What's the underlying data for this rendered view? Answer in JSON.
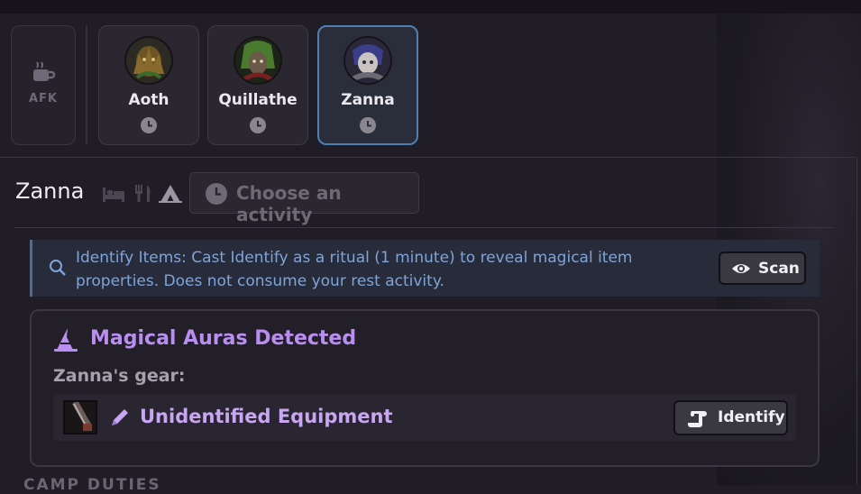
{
  "party": {
    "afk_label": "AFK",
    "members": [
      {
        "name": "Aoth",
        "status_icon": "clock-icon"
      },
      {
        "name": "Quillathe",
        "status_icon": "clock-icon"
      },
      {
        "name": "Zanna",
        "status_icon": "clock-icon",
        "selected": true
      }
    ]
  },
  "selected": {
    "name": "Zanna",
    "rest_icons": [
      "bed-icon",
      "fork-knife-icon",
      "tent-icon"
    ],
    "activity_placeholder": "Choose an activity"
  },
  "identify_info": {
    "text": "Identify Items: Cast Identify as a ritual (1 minute) to reveal magical item properties. Does not consume your rest activity.",
    "scan_label": "Scan"
  },
  "auras": {
    "title": "Magical Auras Detected",
    "gear_label": "Zanna's gear:",
    "items": [
      {
        "name": "Unidentified Equipment",
        "button_label": "Identify"
      }
    ]
  },
  "section_next": "CAMP DUTIES",
  "colors": {
    "background": "#201d26",
    "accent_selected": "#4f7fb3",
    "info_text": "#7fa4da",
    "aura_purple": "#b98ef0"
  }
}
